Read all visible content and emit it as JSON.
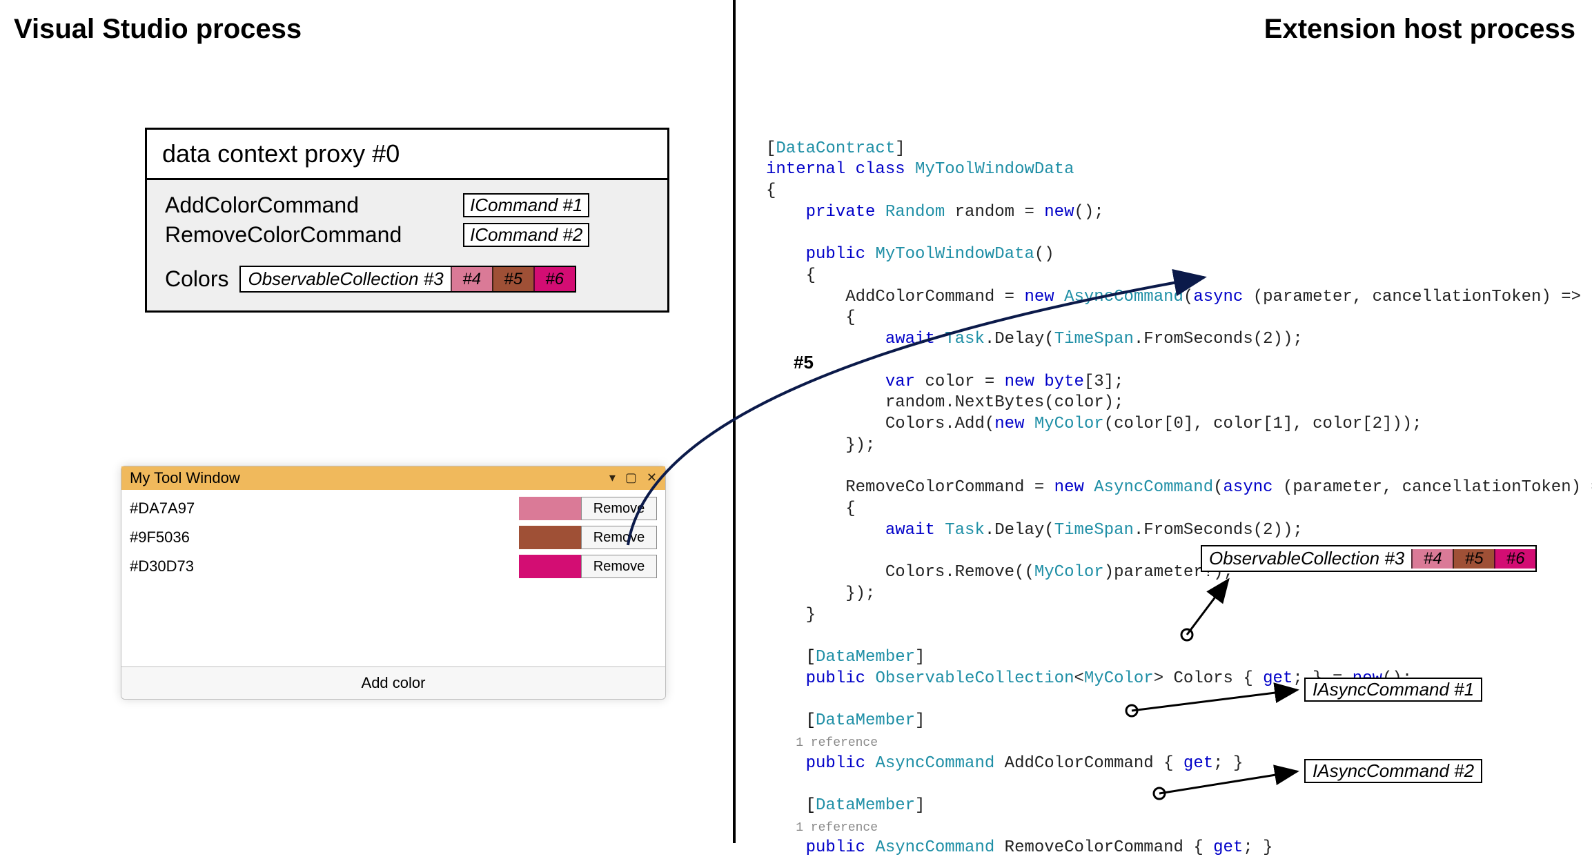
{
  "headings": {
    "left": "Visual Studio process",
    "right": "Extension host process"
  },
  "proxy": {
    "title": "data context proxy #0",
    "add_label": "AddColorCommand",
    "add_tag": "ICommand #1",
    "remove_label": "RemoveColorCommand",
    "remove_tag": "ICommand #2",
    "colors_label": "Colors",
    "obsv_label": "ObservableCollection #3",
    "swatches": [
      {
        "id": "#4",
        "color": "#DA7A97"
      },
      {
        "id": "#5",
        "color": "#9F5036"
      },
      {
        "id": "#6",
        "color": "#D30D73"
      }
    ]
  },
  "toolwindow": {
    "title": "My Tool Window",
    "btn_remove": "Remove",
    "btn_add": "Add color",
    "rows": [
      {
        "hex": "#DA7A97",
        "color": "#DA7A97"
      },
      {
        "hex": "#9F5036",
        "color": "#9F5036"
      },
      {
        "hex": "#D30D73",
        "color": "#D30D73"
      }
    ],
    "icons": {
      "drop": "▾",
      "max": "▢",
      "close": "✕"
    }
  },
  "arrow_label": "#5",
  "right_annotations": {
    "obsv_label": "ObservableCollection #3",
    "obsv_swatches": [
      {
        "id": "#4",
        "color": "#DA7A97"
      },
      {
        "id": "#5",
        "color": "#9F5036"
      },
      {
        "id": "#6",
        "color": "#D30D73"
      }
    ],
    "async1": "IAsyncCommand #1",
    "async2": "IAsyncCommand #2"
  },
  "code": {
    "l01a": "[",
    "l01b": "DataContract",
    "l01c": "]",
    "l02a": "internal class ",
    "l02b": "MyToolWindowData",
    "l03": "{",
    "l04a": "    ",
    "l04b": "private ",
    "l04c": "Random",
    "l04d": " random = ",
    "l04e": "new",
    "l04f": "();",
    "blank1": " ",
    "l05a": "    ",
    "l05b": "public ",
    "l05c": "MyToolWindowData",
    "l05d": "()",
    "l06": "    {",
    "l07a": "        AddColorCommand = ",
    "l07b": "new ",
    "l07c": "AsyncCommand",
    "l07d": "(",
    "l07e": "async ",
    "l07f": "(parameter, cancellationToken) =>",
    "l08": "        {",
    "l09a": "            ",
    "l09b": "await ",
    "l09c": "Task",
    "l09d": ".Delay(",
    "l09e": "TimeSpan",
    "l09f": ".FromSeconds(2));",
    "blank2": " ",
    "l10a": "            ",
    "l10b": "var ",
    "l10c": "color = ",
    "l10d": "new ",
    "l10e": "byte",
    "l10f": "[3];",
    "l11": "            random.NextBytes(color);",
    "l12a": "            Colors.Add(",
    "l12b": "new ",
    "l12c": "MyColor",
    "l12d": "(color[0], color[1], color[2]));",
    "l13": "        });",
    "blank3": " ",
    "l14a": "        RemoveColorCommand = ",
    "l14b": "new ",
    "l14c": "AsyncCommand",
    "l14d": "(",
    "l14e": "async ",
    "l14f": "(parameter, cancellationToken) =>",
    "l15": "        {",
    "l16a": "            ",
    "l16b": "await ",
    "l16c": "Task",
    "l16d": ".Delay(",
    "l16e": "TimeSpan",
    "l16f": ".FromSeconds(2));",
    "blank4": " ",
    "l17a": "            Colors.Remove((",
    "l17b": "MyColor",
    "l17c": ")parameter!);",
    "l18": "        });",
    "l19": "    }",
    "blank5": " ",
    "l20a": "    [",
    "l20b": "DataMember",
    "l20c": "]",
    "l21a": "    ",
    "l21b": "public ",
    "l21c": "ObservableCollection",
    "l21d": "<",
    "l21e": "MyColor",
    "l21f": "> Colors { ",
    "l21g": "get",
    "l21h": "; } = ",
    "l21i": "new",
    "l21j": "();",
    "blank6": " ",
    "l22a": "    [",
    "l22b": "DataMember",
    "l22c": "]",
    "l22ref": "    1 reference",
    "l23a": "    ",
    "l23b": "public ",
    "l23c": "AsyncCommand",
    "l23d": " AddColorCommand { ",
    "l23e": "get",
    "l23f": "; }",
    "blank7": " ",
    "l24a": "    [",
    "l24b": "DataMember",
    "l24c": "]",
    "l24ref": "    1 reference",
    "l25a": "    ",
    "l25b": "public ",
    "l25c": "AsyncCommand",
    "l25d": " RemoveColorCommand { ",
    "l25e": "get",
    "l25f": "; }"
  }
}
